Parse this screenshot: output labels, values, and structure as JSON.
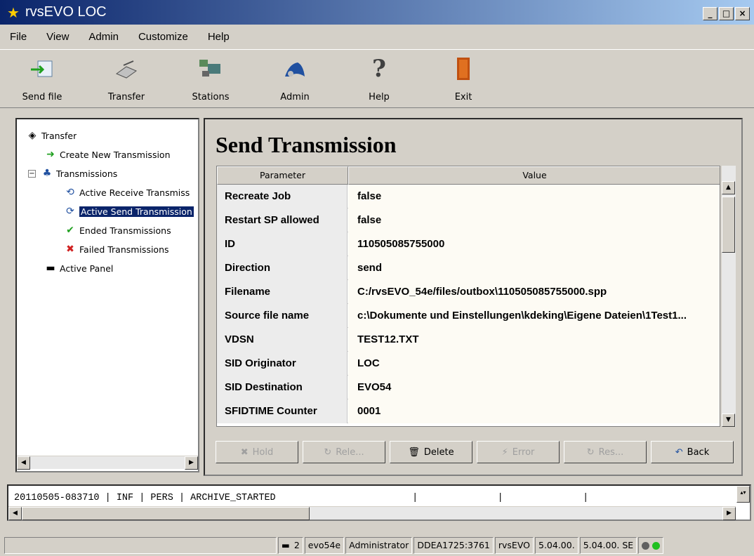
{
  "window": {
    "title": "rvsEVO LOC",
    "controls": [
      "_",
      "□",
      "×"
    ]
  },
  "menu": [
    "File",
    "View",
    "Admin",
    "Customize",
    "Help"
  ],
  "toolbar": [
    {
      "label": "Send file",
      "icon": "send-file-icon"
    },
    {
      "label": "Transfer",
      "icon": "transfer-icon"
    },
    {
      "label": "Stations",
      "icon": "stations-icon"
    },
    {
      "label": "Admin",
      "icon": "admin-icon"
    },
    {
      "label": "Help",
      "icon": "help-icon"
    },
    {
      "label": "Exit",
      "icon": "exit-icon"
    }
  ],
  "tree": {
    "root": "Transfer",
    "create": "Create New Transmission",
    "transmissions": "Transmissions",
    "active_receive": "Active Receive Transmiss",
    "active_send": "Active Send Transmission",
    "ended": "Ended Transmissions",
    "failed": "Failed Transmissions",
    "active_panel": "Active Panel"
  },
  "panel": {
    "title": "Send Transmission",
    "columns": [
      "Parameter",
      "Value"
    ],
    "rows": [
      {
        "param": "Recreate Job",
        "value": "false"
      },
      {
        "param": "Restart SP allowed",
        "value": "false"
      },
      {
        "param": "ID",
        "value": "110505085755000"
      },
      {
        "param": "Direction",
        "value": "send"
      },
      {
        "param": "Filename",
        "value": "C:/rvsEVO_54e/files/outbox\\110505085755000.spp"
      },
      {
        "param": "Source file name",
        "value": "c:\\Dokumente und Einstellungen\\kdeking\\Eigene Dateien\\1Test1..."
      },
      {
        "param": "VDSN",
        "value": "TEST12.TXT"
      },
      {
        "param": "SID Originator",
        "value": "LOC"
      },
      {
        "param": "SID Destination",
        "value": "EVO54"
      },
      {
        "param": "SFIDTIME Counter",
        "value": "0001"
      }
    ],
    "buttons": [
      {
        "label": "Hold",
        "icon": "hold-icon",
        "enabled": false
      },
      {
        "label": "Rele...",
        "icon": "release-icon",
        "enabled": false
      },
      {
        "label": "Delete",
        "icon": "trash-icon",
        "enabled": true
      },
      {
        "label": "Error",
        "icon": "lightning-icon",
        "enabled": false
      },
      {
        "label": "Res...",
        "icon": "restart-icon",
        "enabled": false
      },
      {
        "label": "Back",
        "icon": "undo-icon",
        "enabled": true
      }
    ]
  },
  "log": {
    "line": "20110505-083710 | INF | PERS | ARCHIVE_STARTED                        |              |              |"
  },
  "status": {
    "count": "2",
    "station": "evo54e",
    "user": "Administrator",
    "address": "DDEA1725:3761",
    "app": "rvsEVO",
    "ver1": "5.04.00.",
    "ver2": "5.04.00. SE"
  }
}
